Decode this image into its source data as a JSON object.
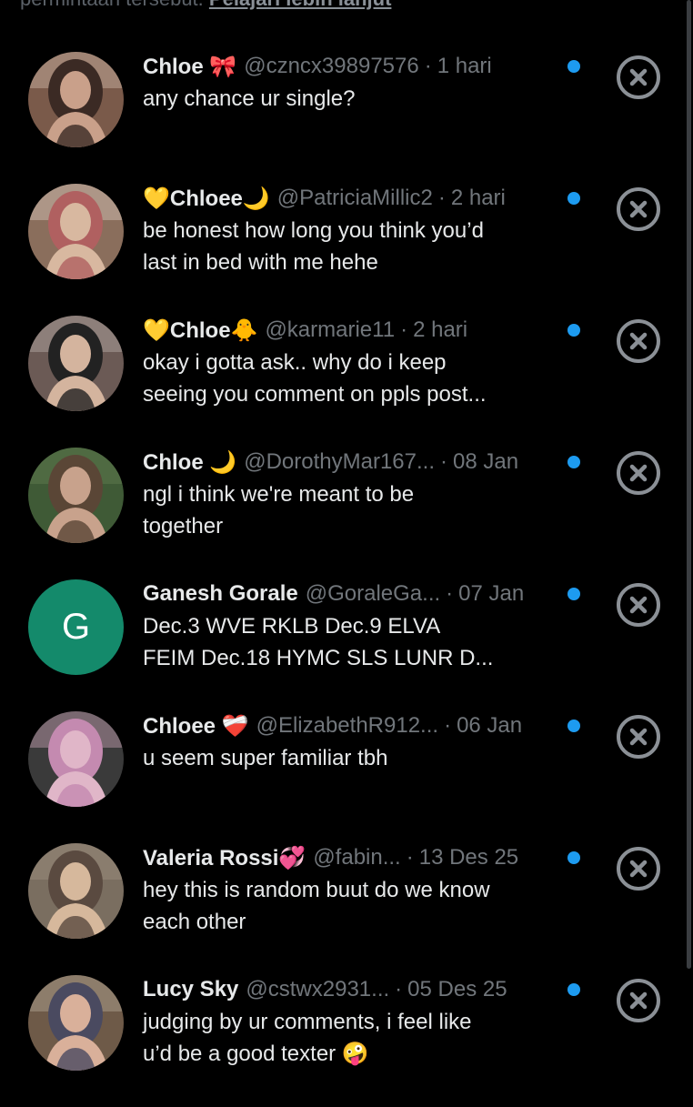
{
  "banner": {
    "text": "permintaan tersebut.",
    "link": "Pelajari lebih lanjut"
  },
  "colors": {
    "background": "#000000",
    "name": "#e7e9ea",
    "muted": "#71767b",
    "unread_dot": "#1d9bf0",
    "letter_avatar": "#148a6b"
  },
  "requests": [
    {
      "name": "Chloe 🎀",
      "handle": "@czncx39897576",
      "separator": "·",
      "time": "1 hari",
      "message": "any chance ur single?",
      "avatar_icon": "profile-photo"
    },
    {
      "name": "💛Chloee🌙",
      "handle": "@PatriciaMillic2",
      "separator": "·",
      "time": "2 hari",
      "message": "be honest how long you think you’d\nlast in bed with me hehe",
      "avatar_icon": "profile-photo"
    },
    {
      "name": "💛Chloe🐥",
      "handle": "@karmarie11",
      "separator": "·",
      "time": "2 hari",
      "message": "okay i gotta ask.. why do i keep\nseeing you comment on ppls post...",
      "avatar_icon": "profile-photo"
    },
    {
      "name": "Chloe 🌙",
      "handle": "@DorothyMar167...",
      "separator": "·",
      "time": "08 Jan",
      "message": "ngl i think we're meant to be\ntogether",
      "avatar_icon": "profile-photo"
    },
    {
      "name": "Ganesh Gorale",
      "handle": "@GoraleGa...",
      "separator": "·",
      "time": "07 Jan",
      "message": "Dec.3   WVE  RKLB   Dec.9   ELVA\nFEIM Dec.18  HYMC  SLS  LUNR   D...",
      "avatar_letter": "G"
    },
    {
      "name": "Chloee ❤️‍🩹",
      "handle": "@ElizabethR912...",
      "separator": "·",
      "time": "06 Jan",
      "message": "u seem super familiar tbh",
      "avatar_icon": "profile-photo"
    },
    {
      "name": "Valeria Rossi💞",
      "handle": "@fabin...",
      "separator": "·",
      "time": "13 Des 25",
      "message": "hey this is random buut do we know\neach other",
      "avatar_icon": "profile-photo"
    },
    {
      "name": "Lucy Sky",
      "handle": "@cstwx2931...",
      "separator": "·",
      "time": "05 Des 25",
      "message": "judging by ur comments, i feel like\nu’d be a good texter 🤪",
      "avatar_icon": "profile-photo"
    }
  ]
}
